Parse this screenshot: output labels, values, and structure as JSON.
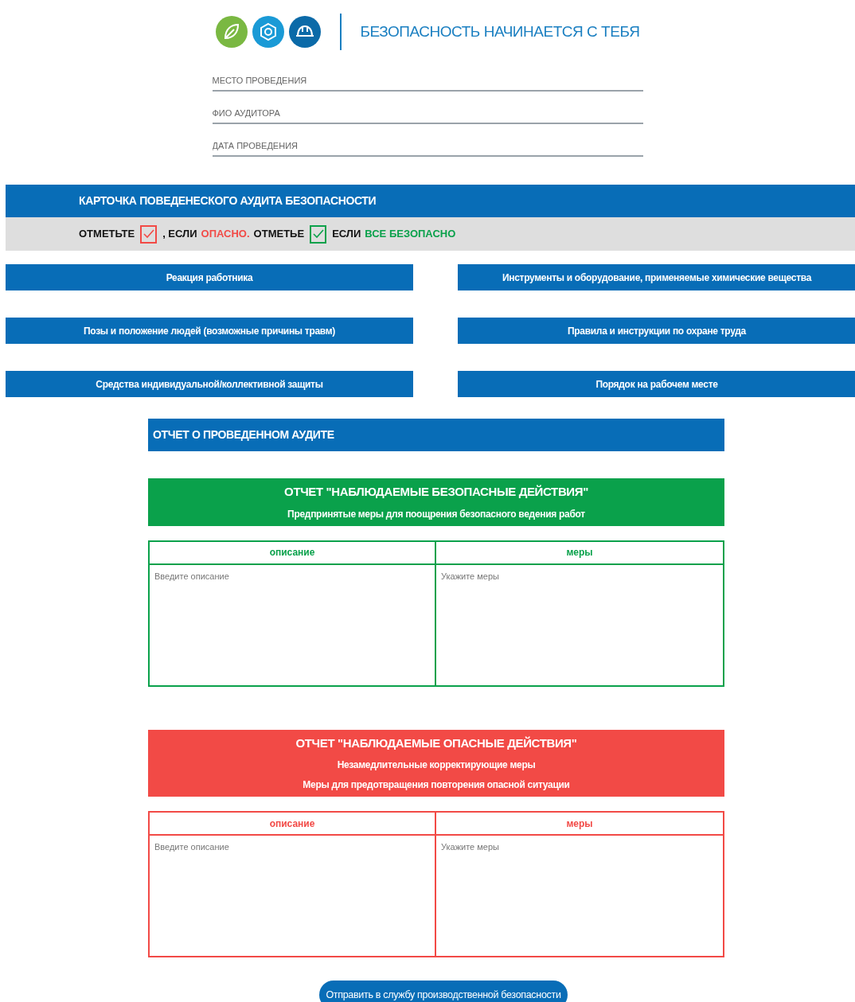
{
  "header": {
    "title": "БЕЗОПАСНОСТЬ НАЧИНАЕТСЯ С ТЕБЯ"
  },
  "fields": [
    {
      "placeholder": "МЕСТО ПРОВЕДЕНИЯ"
    },
    {
      "placeholder": "ФИО АУДИТОРА"
    },
    {
      "placeholder": "ДАТА ПРОВЕДЕНИЯ"
    }
  ],
  "card": {
    "title": "КАРТОЧКА ПОВЕДЕНЕСКОГО АУДИТА БЕЗОПАСНОСТИ",
    "legend": [
      {
        "kind": "text",
        "text": "ОТМЕТЬТЕ"
      },
      {
        "kind": "check",
        "color": "#f24a46"
      },
      {
        "kind": "text",
        "text": ", ЕСЛИ"
      },
      {
        "kind": "text",
        "text": "ОПАСНО.",
        "color": "#f24a46"
      },
      {
        "kind": "text",
        "text": "ОТМЕТЬЕ"
      },
      {
        "kind": "check",
        "color": "#0aa14b"
      },
      {
        "kind": "text",
        "text": "ЕСЛИ"
      },
      {
        "kind": "text",
        "text": "ВСЕ БЕЗОПАСНО",
        "color": "#0aa14b"
      }
    ]
  },
  "categories": [
    "Реакция работника",
    "Инструменты и оборудование, применяемые химические вещества",
    "Позы и положение людей (возможные причины травм)",
    "Правила и инструкции по охране труда",
    "Средства индивидуальной/коллективной защиты",
    "Порядок на рабочем месте"
  ],
  "report": {
    "title": "ОТЧЕТ О ПРОВЕДЕННОМ АУДИТЕ",
    "sections": [
      {
        "color": "#0aa14b",
        "title": "ОТЧЕТ \"НАБЛЮДАЕМЫЕ БЕЗОПАСНЫЕ ДЕЙСТВИЯ\"",
        "subtitles": [
          "Предпринятые меры для поощрения безопасного ведения работ"
        ],
        "columns": [
          {
            "label": "описание",
            "placeholder": "Введите описание"
          },
          {
            "label": "меры",
            "placeholder": "Укажите меры"
          }
        ]
      },
      {
        "color": "#f24a46",
        "title": "ОТЧЕТ \"НАБЛЮДАЕМЫЕ ОПАСНЫЕ ДЕЙСТВИЯ\"",
        "subtitles": [
          "Незамедлительные корректирующие меры",
          "Меры для предотвращения повторения опасной ситуации"
        ],
        "columns": [
          {
            "label": "описание",
            "placeholder": "Введите описание"
          },
          {
            "label": "меры",
            "placeholder": "Укажите меры"
          }
        ]
      }
    ]
  },
  "submit": {
    "label": "Отправить в службу производственной безопасности"
  }
}
